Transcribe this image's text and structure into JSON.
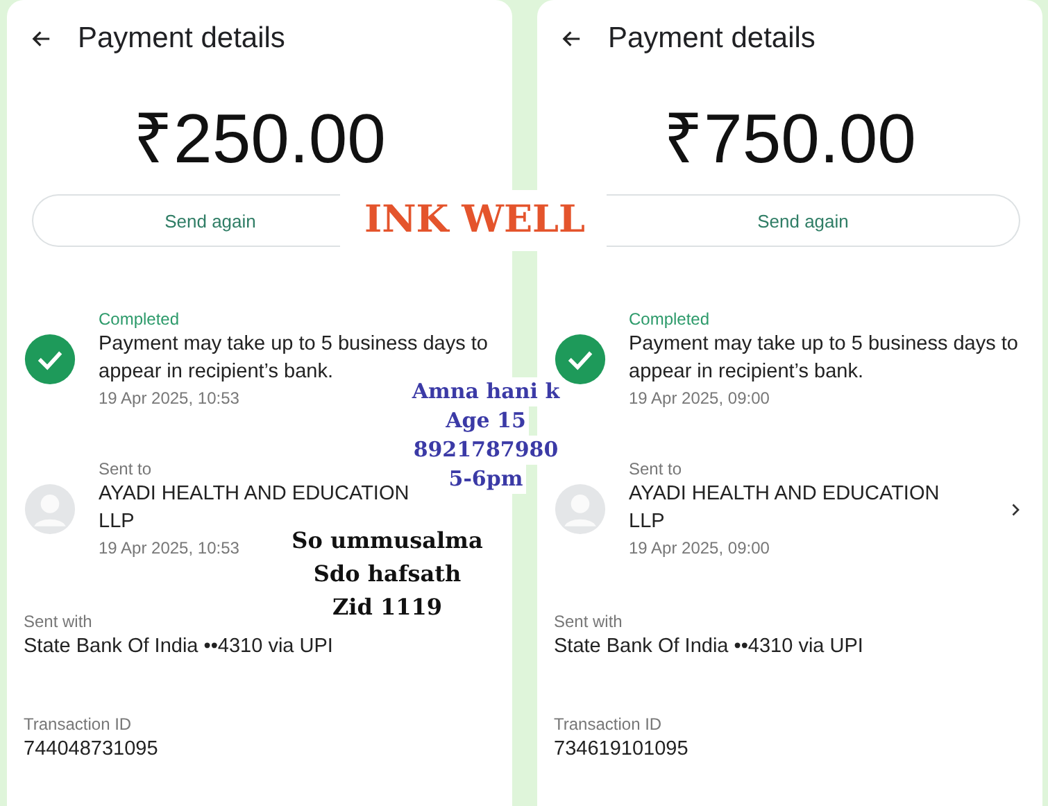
{
  "panels": [
    {
      "title": "Payment details",
      "amount": "₹250.00",
      "send_again": "Send again",
      "status": {
        "label": "Completed",
        "message": "Payment may take up to 5 business days to appear in recipient’s bank.",
        "time": "19 Apr 2025, 10:53"
      },
      "sent_to": {
        "label": "Sent to",
        "name": "AYADI HEALTH AND EDUCATION LLP",
        "time": "19 Apr 2025, 10:53",
        "chevron": false
      },
      "sent_with": {
        "label": "Sent with",
        "value": "State Bank Of India ••4310 via UPI"
      },
      "transaction": {
        "label": "Transaction ID",
        "value": "744048731095"
      }
    },
    {
      "title": "Payment details",
      "amount": "₹750.00",
      "send_again": "Send again",
      "status": {
        "label": "Completed",
        "message": "Payment may take up to 5 business days to appear in recipient’s bank.",
        "time": "19 Apr 2025, 09:00"
      },
      "sent_to": {
        "label": "Sent to",
        "name": "AYADI HEALTH AND EDUCATION LLP",
        "time": "19 Apr 2025, 09:00",
        "chevron": true
      },
      "sent_with": {
        "label": "Sent with",
        "value": "State Bank Of India ••4310 via UPI"
      },
      "transaction": {
        "label": "Transaction ID",
        "value": "734619101095"
      }
    }
  ],
  "brand_label": "INK WELL",
  "annotations": [
    {
      "color": "#3b3aa6",
      "lines": [
        "Amna hani k",
        "Age 15",
        "8921787980",
        "5-6pm"
      ]
    },
    {
      "color": "#111111",
      "lines": [
        "So ummusalma",
        "Sdo hafsath",
        "Zid 1119"
      ]
    }
  ]
}
